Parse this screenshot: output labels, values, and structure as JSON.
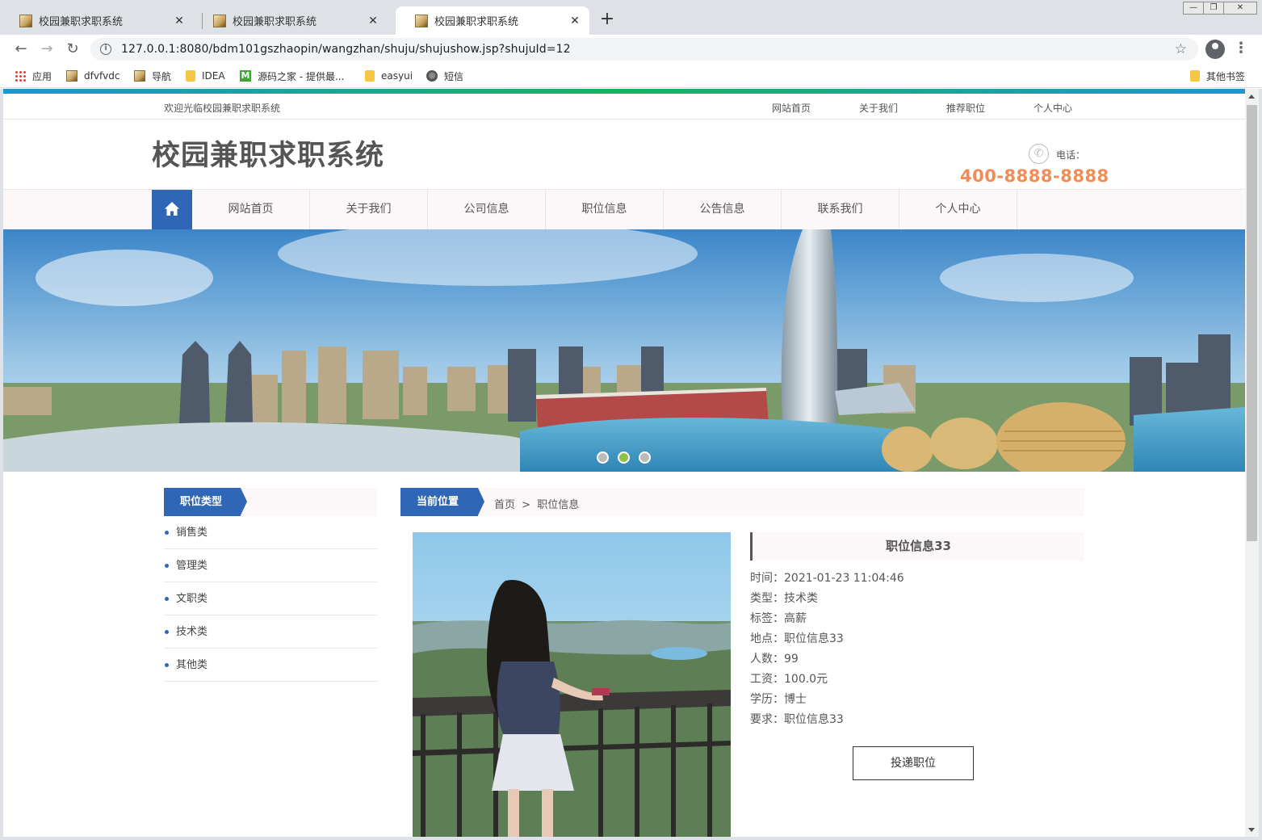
{
  "browser": {
    "tabs": [
      {
        "title": "校园兼职求职系统",
        "active": false
      },
      {
        "title": "校园兼职求职系统",
        "active": false
      },
      {
        "title": "校园兼职求职系统",
        "active": true
      }
    ],
    "close_glyph": "✕",
    "new_tab_glyph": "+",
    "window_buttons": [
      "—",
      "❐",
      "✕"
    ],
    "url": "127.0.0.1:8080/bdm101gszhaopin/wangzhan/shuju/shujushow.jsp?shujuId=12",
    "bookmarks": [
      {
        "label": "应用",
        "icon": "apps-grid-icon"
      },
      {
        "label": "dfvfvdc",
        "icon": "image-favicon-icon"
      },
      {
        "label": "导航",
        "icon": "image-favicon-icon"
      },
      {
        "label": "IDEA",
        "icon": "folder-icon"
      },
      {
        "label": "源码之家 - 提供最...",
        "icon": "m-logo-icon"
      },
      {
        "label": "easyui",
        "icon": "folder-icon"
      },
      {
        "label": "短信",
        "icon": "globe-icon"
      }
    ],
    "other_bookmarks": "其他书签"
  },
  "site": {
    "welcome": "欢迎光临校园兼职求职系统",
    "top_links": [
      "网站首页",
      "关于我们",
      "推荐职位",
      "个人中心"
    ],
    "title": "校园兼职求职系统",
    "phone_label": "电话：",
    "phone_number": "400-8888-8888",
    "nav": [
      "网站首页",
      "关于我们",
      "公司信息",
      "职位信息",
      "公告信息",
      "联系我们",
      "个人中心"
    ],
    "banner_slides": 3,
    "banner_active_slide": 2,
    "accent_color": "#2f66b5",
    "phone_color": "#f08c56"
  },
  "sidebar": {
    "heading": "职位类型",
    "items": [
      "销售类",
      "管理类",
      "文职类",
      "技术类",
      "其他类"
    ]
  },
  "breadcrumb": {
    "heading": "当前位置",
    "home": "首页",
    "separator": ">",
    "current": "职位信息"
  },
  "job": {
    "title": "职位信息33",
    "fields": [
      {
        "label": "时间：",
        "value": "2021-01-23 11:04:46"
      },
      {
        "label": "类型：",
        "value": "技术类"
      },
      {
        "label": "标签：",
        "value": "高薪"
      },
      {
        "label": "地点：",
        "value": "职位信息33"
      },
      {
        "label": "人数：",
        "value": "99"
      },
      {
        "label": "工资：",
        "value": "100.0元"
      },
      {
        "label": "学历：",
        "value": "博士"
      },
      {
        "label": "要求：",
        "value": "职位信息33"
      }
    ],
    "apply_label": "投递职位"
  }
}
